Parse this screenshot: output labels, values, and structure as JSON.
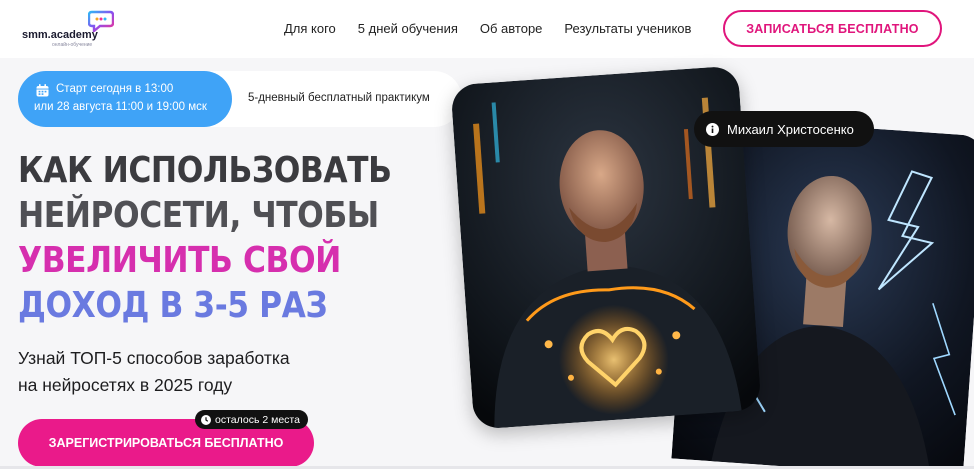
{
  "header": {
    "logo_text": "smm.academy",
    "logo_subtext": "онлайн-обучение",
    "nav": [
      "Для кого",
      "5 дней обучения",
      "Об авторе",
      "Результаты учеников"
    ],
    "cta_label": "ЗАПИСАТЬСЯ БЕСПЛАТНО"
  },
  "info": {
    "date_line1": "Старт сегодня в 13:00",
    "date_line2": "или 28 августа 11:00 и 19:00 мск",
    "practicum": "5-дневный бесплатный практикум"
  },
  "headline": {
    "line1": "КАК ИСПОЛЬЗОВАТЬ",
    "line2": "НЕЙРОСЕТИ, ЧТОБЫ",
    "line3": "УВЕЛИЧИТЬ СВОЙ",
    "line4": "ДОХОД В 3-5 РАЗ"
  },
  "subtitle": {
    "line1": "Узнай ТОП-5 способов заработка",
    "line2": "на нейросетях в 2025 году"
  },
  "cta_main": {
    "label": "ЗАРЕГИСТРИРОВАТЬСЯ БЕСПЛАТНО",
    "seats_badge": "осталось 2 места"
  },
  "author": {
    "name": "Михаил Христосенко"
  },
  "colors": {
    "accent_pink": "#e0157c",
    "accent_blue": "#3fa3f7",
    "headline_pink": "#d62fae",
    "headline_blue": "#6a7ae0"
  },
  "icons": [
    "calendar-icon",
    "clock-icon",
    "info-icon",
    "chat-bubble-logo"
  ]
}
